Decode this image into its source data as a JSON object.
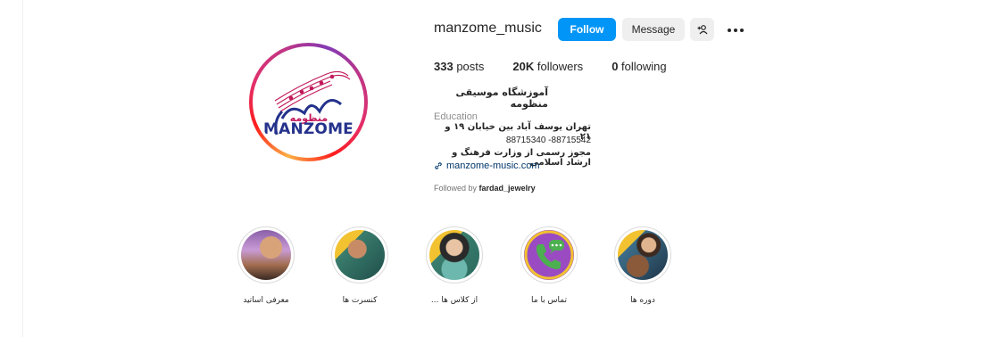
{
  "profile": {
    "username": "manzome_music",
    "follow_label": "Follow",
    "message_label": "Message",
    "logo_text": "MANZOME",
    "logo_fa": "منظومه"
  },
  "stats": {
    "posts_count": "333",
    "posts_label": "posts",
    "followers_count": "20K",
    "followers_label": "followers",
    "following_count": "0",
    "following_label": "following"
  },
  "bio": {
    "full_name": "آموزشگاه موسیقی منظومه",
    "category": "Education",
    "line1": "تهران یوسف آباد بین خیابان ۱۹ و ۲۱",
    "line2": "88715340 -88715542",
    "line3": "مجوز رسمی از وزارت فرهنگ و ارشاد اسلامی",
    "link": "manzome-music.com",
    "followed_by_prefix": "Followed by",
    "followed_by_user": "fardad_jewelry"
  },
  "highlights": [
    {
      "label": "معرفی اساتید"
    },
    {
      "label": "کنسرت ها"
    },
    {
      "label": "از کلاس ها ..."
    },
    {
      "label": "تماس با ما"
    },
    {
      "label": "دوره ها"
    }
  ],
  "icons": [
    "add-user-icon",
    "more-options-icon",
    "link-icon",
    "whatsapp-icon"
  ],
  "colors": {
    "follow_button": "#0095f6",
    "secondary_button": "#efefef",
    "link": "#00376b",
    "logo_blue": "#24328c",
    "logo_magenta": "#c2185b"
  }
}
